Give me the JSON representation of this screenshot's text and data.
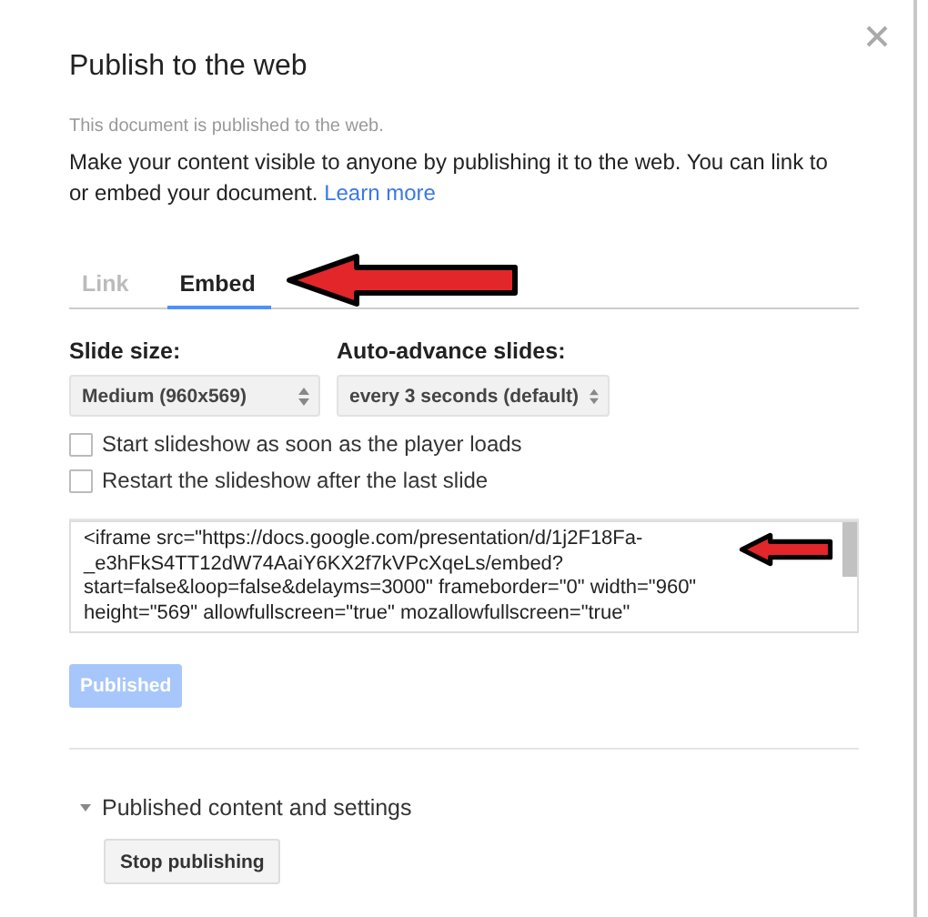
{
  "dialog": {
    "title": "Publish to the web",
    "status_note": "This document is published to the web.",
    "description": "Make your content visible to anyone by publishing it to the web. You can link to or embed your document.",
    "learn_more": "Learn more"
  },
  "tabs": [
    {
      "label": "Link",
      "selected": false
    },
    {
      "label": "Embed",
      "selected": true
    }
  ],
  "selects": [
    {
      "label": "Slide size:",
      "value": "Medium (960x569)"
    },
    {
      "label": "Auto-advance slides:",
      "value": "every 3 seconds (default)"
    }
  ],
  "checkboxes": [
    {
      "label": "Start slideshow as soon as the player loads",
      "checked": false
    },
    {
      "label": "Restart the slideshow after the last slide",
      "checked": false
    }
  ],
  "embed_code": "<iframe src=\"https://docs.google.com/presentation/d/1j2F18Fa-_e3hFkS4TT12dW74AaiY6KX2f7kVPcXqeLs/embed?start=false&loop=false&delayms=3000\" frameborder=\"0\" width=\"960\" height=\"569\" allowfullscreen=\"true\" mozallowfullscreen=\"true\"",
  "publish_button": {
    "label": "Published",
    "disabled": true
  },
  "published_section": {
    "label": "Published content and settings",
    "expanded": true,
    "stop_button": "Stop publishing"
  }
}
